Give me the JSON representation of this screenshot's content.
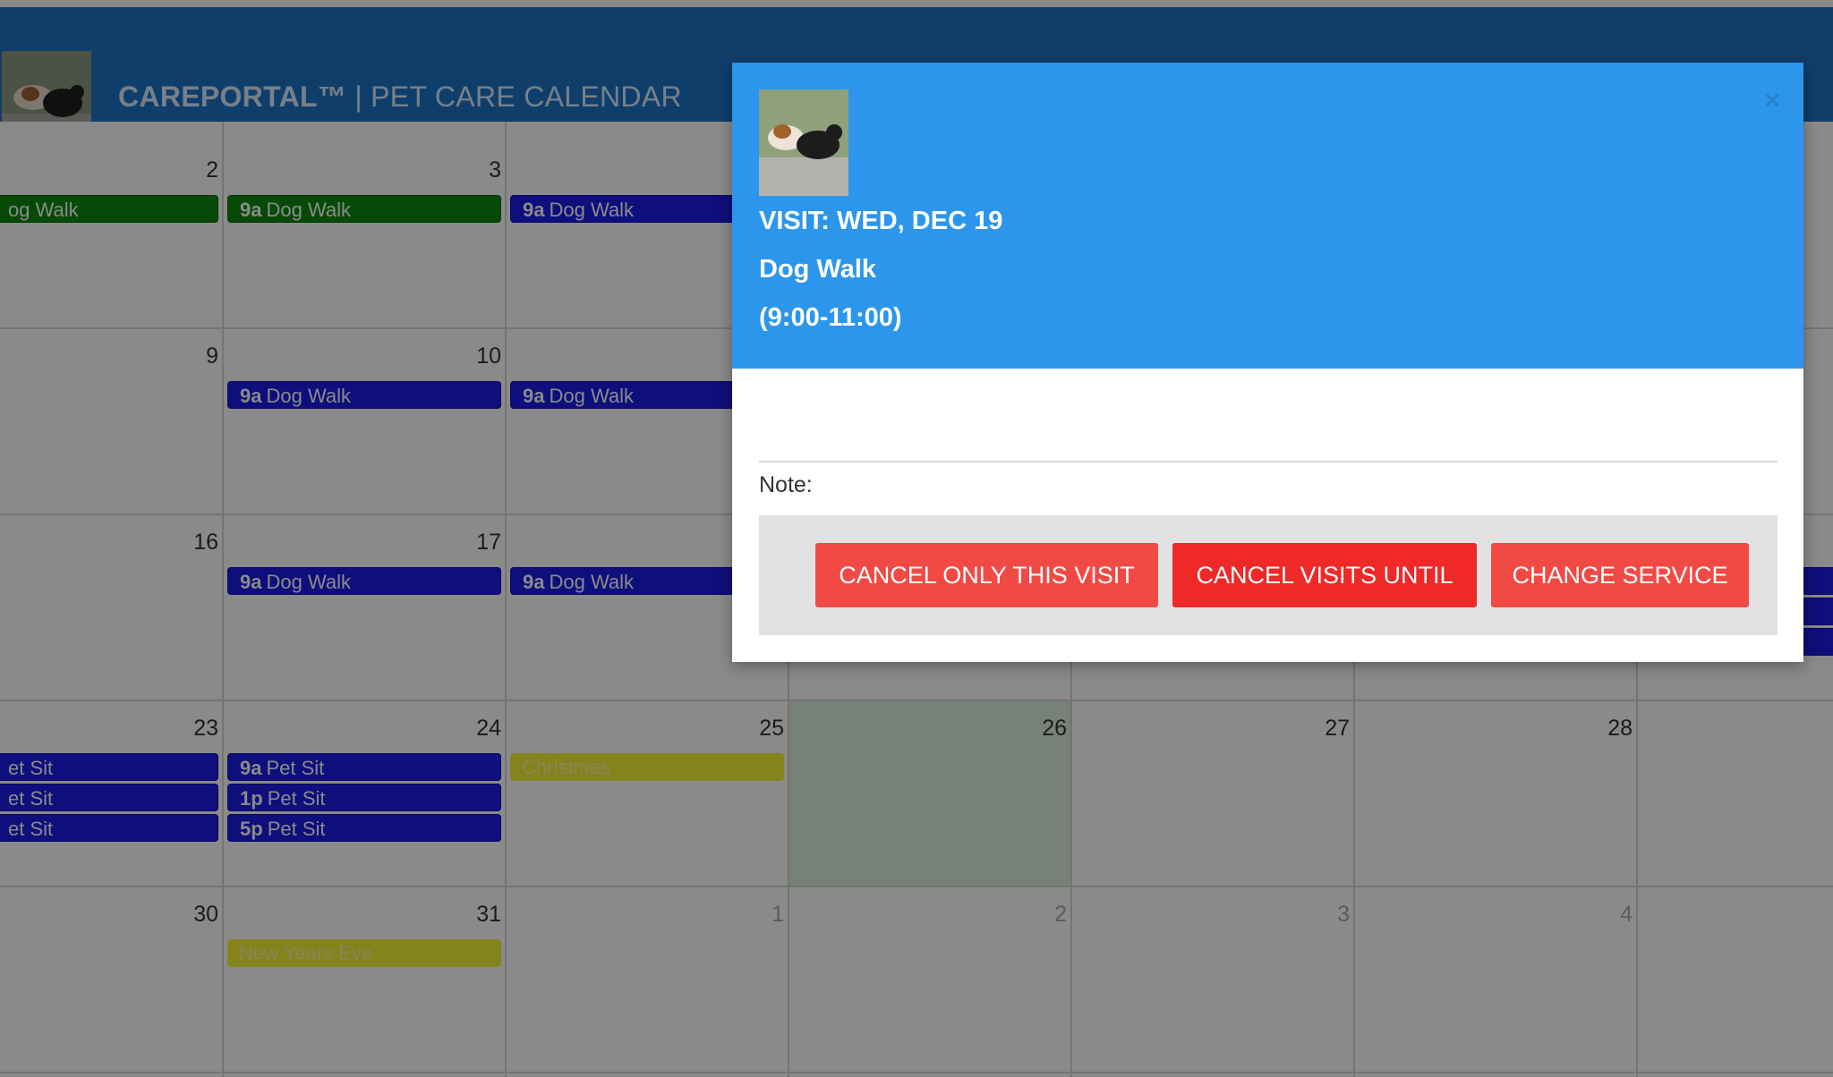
{
  "header": {
    "brand_bold": "CAREPORTAL™",
    "brand_separator": " | ",
    "brand_rest": "PET CARE CALENDAR",
    "logo_photo": "dog-photo"
  },
  "calendar": {
    "day_numbers": [
      "2",
      "3",
      "9",
      "10",
      "16",
      "17",
      "23",
      "24",
      "25",
      "26",
      "27",
      "28",
      "30",
      "31",
      "1",
      "2",
      "3",
      "4"
    ],
    "events": {
      "w1_c0": {
        "time": "",
        "label": "og Walk"
      },
      "w1_c1": {
        "time": "9a",
        "label": "Dog Walk"
      },
      "w1_c2": {
        "time": "9a",
        "label": "Dog Walk"
      },
      "w2_c1": {
        "time": "9a",
        "label": "Dog Walk"
      },
      "w2_c2": {
        "time": "9a",
        "label": "Dog Walk"
      },
      "w3_c1": {
        "time": "9a",
        "label": "Dog Walk"
      },
      "w3_c2": {
        "time": "9a",
        "label": "Dog Walk"
      },
      "w4_c0a": {
        "time": "",
        "label": "et Sit"
      },
      "w4_c0b": {
        "time": "",
        "label": "et Sit"
      },
      "w4_c0c": {
        "time": "",
        "label": "et Sit"
      },
      "w4_c1a": {
        "time": "9a",
        "label": "Pet Sit"
      },
      "w4_c1b": {
        "time": "1p",
        "label": "Pet Sit"
      },
      "w4_c1c": {
        "time": "5p",
        "label": "Pet Sit"
      },
      "w4_c2": {
        "time": "",
        "label": "Christmas"
      },
      "w5_c1": {
        "time": "",
        "label": "New Years Eve"
      }
    }
  },
  "modal": {
    "photo": "dog-photo",
    "close": "×",
    "visit_date": "VISIT: WED, DEC 19",
    "service": "Dog Walk",
    "time_range": "(9:00-11:00)",
    "note_label": "Note:",
    "buttons": {
      "cancel_this": "CANCEL ONLY THIS VISIT",
      "cancel_until": "CANCEL VISITS UNTIL",
      "change_service": "CHANGE SERVICE"
    }
  },
  "colors": {
    "header": "#1f74c4",
    "modal_header": "#2b96ec",
    "event_blue": "#1a1ae6",
    "event_green": "#0d8a0d",
    "event_yellow": "#f5f235",
    "button_red": "#f14a45",
    "today_shade": "#dcefdc"
  }
}
